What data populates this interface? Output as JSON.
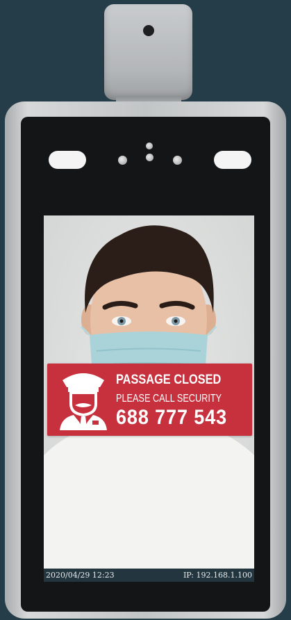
{
  "alert": {
    "title": "PASSAGE CLOSED",
    "subtitle": "PLEASE CALL SECURITY",
    "phone": "688 777 543",
    "icon": "security-guard-icon",
    "color": "#c7313e"
  },
  "status_bar": {
    "datetime": "2020/04/29  12:23",
    "ip": "IP: 192.168.1.100"
  },
  "colors": {
    "background": "#253d48",
    "bezel": "#141516",
    "status_bar": "#23353f"
  }
}
